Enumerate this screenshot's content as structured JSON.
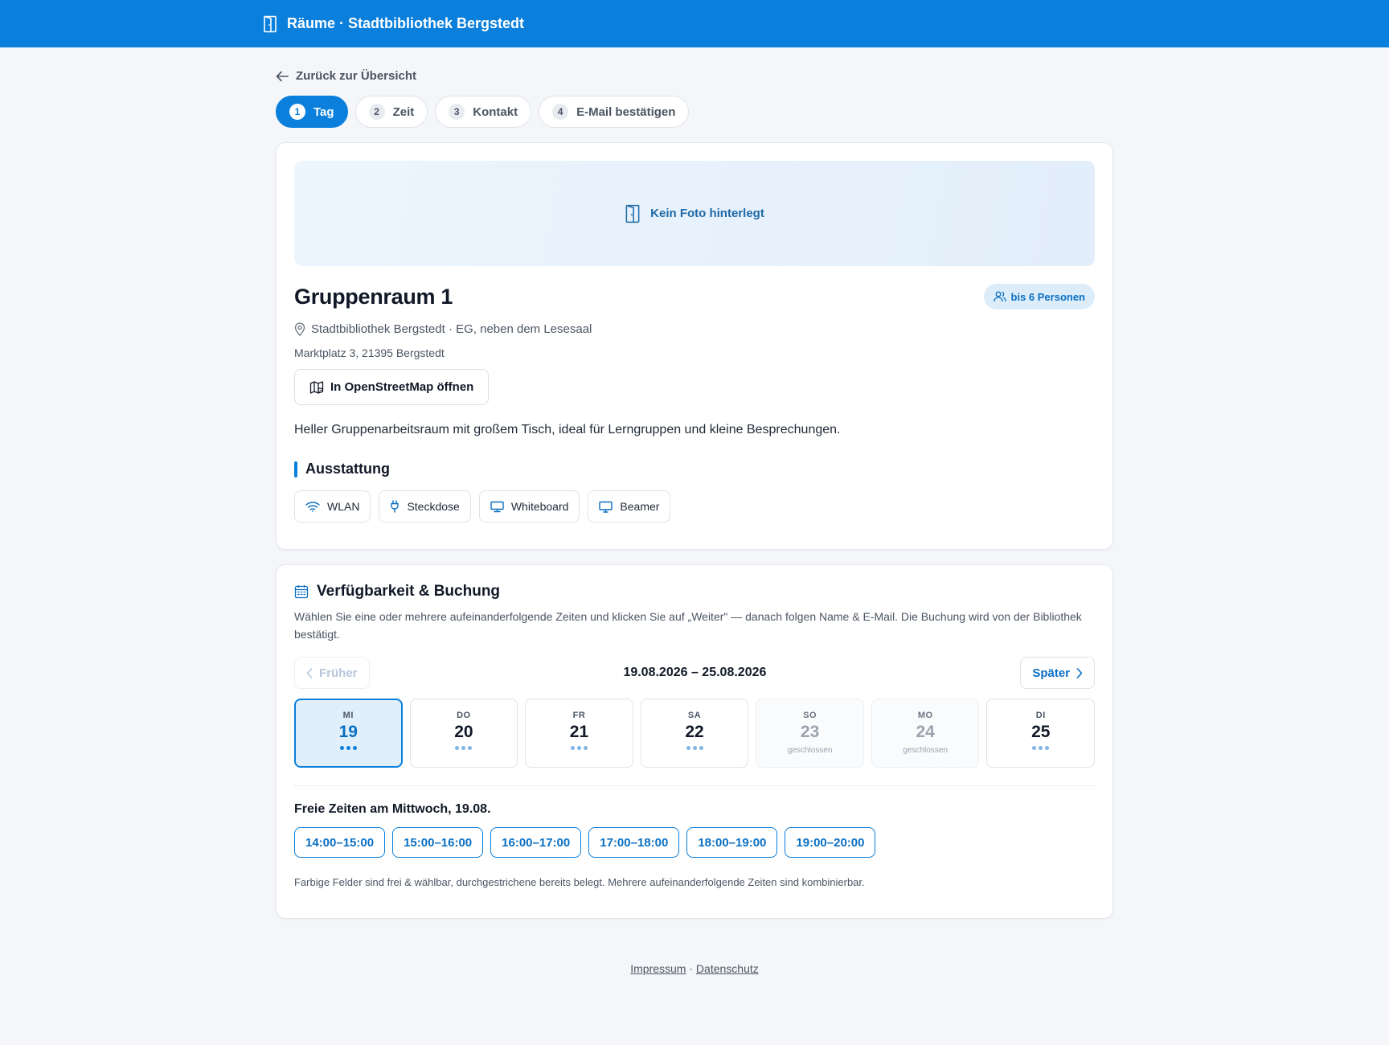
{
  "header": {
    "title": "Räume · Stadtbibliothek Bergstedt",
    "icon": "door-icon",
    "color": "#0a7fdb"
  },
  "back_link": {
    "label": "Zurück zur Übersicht"
  },
  "steps": [
    {
      "num": "1",
      "label": "Tag",
      "active": true
    },
    {
      "num": "2",
      "label": "Zeit",
      "active": false
    },
    {
      "num": "3",
      "label": "Kontakt",
      "active": false
    },
    {
      "num": "4",
      "label": "E-Mail bestätigen",
      "active": false
    }
  ],
  "room": {
    "photo_placeholder": "Kein Foto hinterlegt",
    "title": "Gruppenraum 1",
    "capacity": "bis 6 Personen",
    "location": "Stadtbibliothek Bergstedt · EG, neben dem Lesesaal",
    "address": "Marktplatz 3, 21395 Bergstedt",
    "osm_button": "In OpenStreetMap öffnen",
    "description": "Heller Gruppenarbeitsraum mit großem Tisch, ideal für Lerngruppen und kleine Besprechungen.",
    "features_title": "Ausstattung",
    "features": [
      {
        "label": "WLAN",
        "icon": "wifi-icon"
      },
      {
        "label": "Steckdose",
        "icon": "plug-icon"
      },
      {
        "label": "Whiteboard",
        "icon": "whiteboard-icon"
      },
      {
        "label": "Beamer",
        "icon": "monitor-icon"
      }
    ]
  },
  "booking": {
    "title": "Verfügbarkeit & Buchung",
    "description": "Wählen Sie eine oder mehrere aufeinanderfolgende Zeiten und klicken Sie auf „Weiter\" — danach folgen Name & E-Mail. Die Buchung wird von der Bibliothek bestätigt.",
    "prev_label": "Früher",
    "next_label": "Später",
    "week_range": "19.08.2026 – 25.08.2026",
    "days": [
      {
        "dow": "MI",
        "date": "19",
        "status": "selected"
      },
      {
        "dow": "DO",
        "date": "20",
        "status": "available"
      },
      {
        "dow": "FR",
        "date": "21",
        "status": "available"
      },
      {
        "dow": "SA",
        "date": "22",
        "status": "available"
      },
      {
        "dow": "SO",
        "date": "23",
        "status": "closed",
        "note": "geschlossen"
      },
      {
        "dow": "MO",
        "date": "24",
        "status": "closed",
        "note": "geschlossen"
      },
      {
        "dow": "DI",
        "date": "25",
        "status": "available"
      }
    ],
    "slots_title": "Freie Zeiten am Mittwoch, 19.08.",
    "slots": [
      "14:00–15:00",
      "15:00–16:00",
      "16:00–17:00",
      "17:00–18:00",
      "18:00–19:00",
      "19:00–20:00"
    ],
    "hint": "Farbige Felder sind frei & wählbar, durchgestrichene bereits belegt. Mehrere aufeinanderfolgende Zeiten sind kombinierbar."
  },
  "footer": {
    "impressum": "Impressum",
    "separator": "·",
    "datenschutz": "Datenschutz"
  }
}
